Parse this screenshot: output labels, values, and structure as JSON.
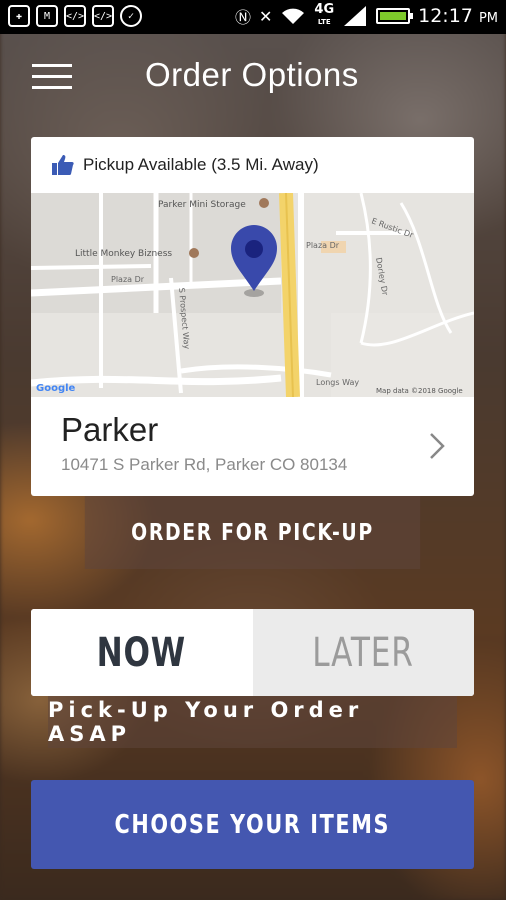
{
  "status_bar": {
    "time": "12:17",
    "ampm": "PM",
    "network": "4G",
    "network_sub": "LTE",
    "left_icons": [
      "plus-icon",
      "gmail-icon",
      "code-icon",
      "code-icon",
      "messenger-icon"
    ],
    "right_icons": [
      "nfc-icon",
      "mute-icon",
      "wifi-icon",
      "signal-icon",
      "battery-icon"
    ]
  },
  "header": {
    "title": "Order Options"
  },
  "location_card": {
    "pickup_label": "Pickup Available (3.5 Mi. Away)",
    "thumb_color": "#3b5bb5",
    "name": "Parker",
    "address": "10471 S Parker Rd, Parker CO 80134",
    "map": {
      "labels": {
        "storage": "Parker Mini Storage",
        "monkey": "Little Monkey Bizness",
        "plaza_dr_1": "Plaza Dr",
        "plaza_dr_2": "Plaza Dr",
        "pine_way": "S Prospect Way",
        "rustic": "E Rustic Dr",
        "dorley": "Dorley Dr",
        "longs": "Longs Way",
        "google": "Google",
        "map_data": "Map data ©2018 Google"
      },
      "pin_color": "#3949ab"
    }
  },
  "order_button": {
    "label": "ORDER FOR PICK-UP"
  },
  "time_toggle": {
    "now_label": "NOW",
    "later_label": "LATER",
    "selected": "NOW"
  },
  "asap_text": "Pick-Up Your Order ASAP",
  "choose_button": {
    "label": "CHOOSE YOUR ITEMS",
    "color": "#4457b0"
  }
}
